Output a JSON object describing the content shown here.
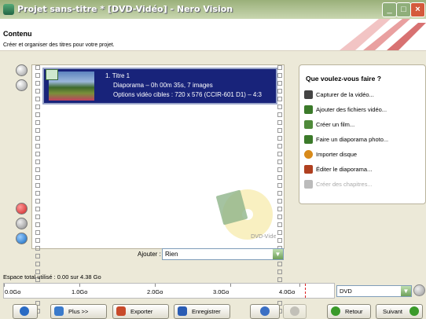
{
  "window": {
    "title": "Projet sans-titre * [DVD-Vidéo] - Nero Vision"
  },
  "header": {
    "title": "Contenu",
    "subtitle": "Créer et organiser des titres pour votre projet."
  },
  "content": {
    "entry": {
      "title": "1. Titre 1",
      "line2": "Diaporama – 0h 00m 35s, 7 images",
      "line3": "Options vidéo cibles : 720 x 576 (CCIR-601 D1) – 4:3"
    },
    "watermark_label": "DVD-Video"
  },
  "add": {
    "label": "Ajouter :",
    "value": "Rien"
  },
  "actions": {
    "heading": "Que voulez-vous faire ?",
    "items": [
      {
        "label": "Capturer de la vidéo...",
        "icon": "camera-icon",
        "color": "#444444"
      },
      {
        "label": "Ajouter des fichiers vidéo...",
        "icon": "add-files-icon",
        "color": "#3b7a2a"
      },
      {
        "label": "Créer un film...",
        "icon": "film-icon",
        "color": "#4f8a3a"
      },
      {
        "label": "Faire un diaporama photo...",
        "icon": "slideshow-icon",
        "color": "#3b7a2a"
      },
      {
        "label": "Importer disque",
        "icon": "disc-import-icon",
        "color": "#d88a1a"
      },
      {
        "label": "Éditer le diaporama...",
        "icon": "edit-slideshow-icon",
        "color": "#b04020"
      },
      {
        "label": "Créer des chapitres...",
        "icon": "chapters-icon",
        "color": "#bbbbbb",
        "disabled": true
      }
    ]
  },
  "space": {
    "label": "Espace total utilisé : 0.00 sur 4.38 Go",
    "scale": [
      "0.0Go",
      "1.0Go",
      "2.0Go",
      "3.0Go",
      "4.0Go"
    ],
    "disc_type": "DVD"
  },
  "buttons": {
    "more": "Plus >>",
    "export": "Exporter",
    "save": "Enregistrer",
    "back": "Retour",
    "next": "Suivant"
  },
  "colors": {
    "entry_bg": "#18237a",
    "title_bar": "#9ab07a",
    "accent_red": "#cc2a2a"
  }
}
